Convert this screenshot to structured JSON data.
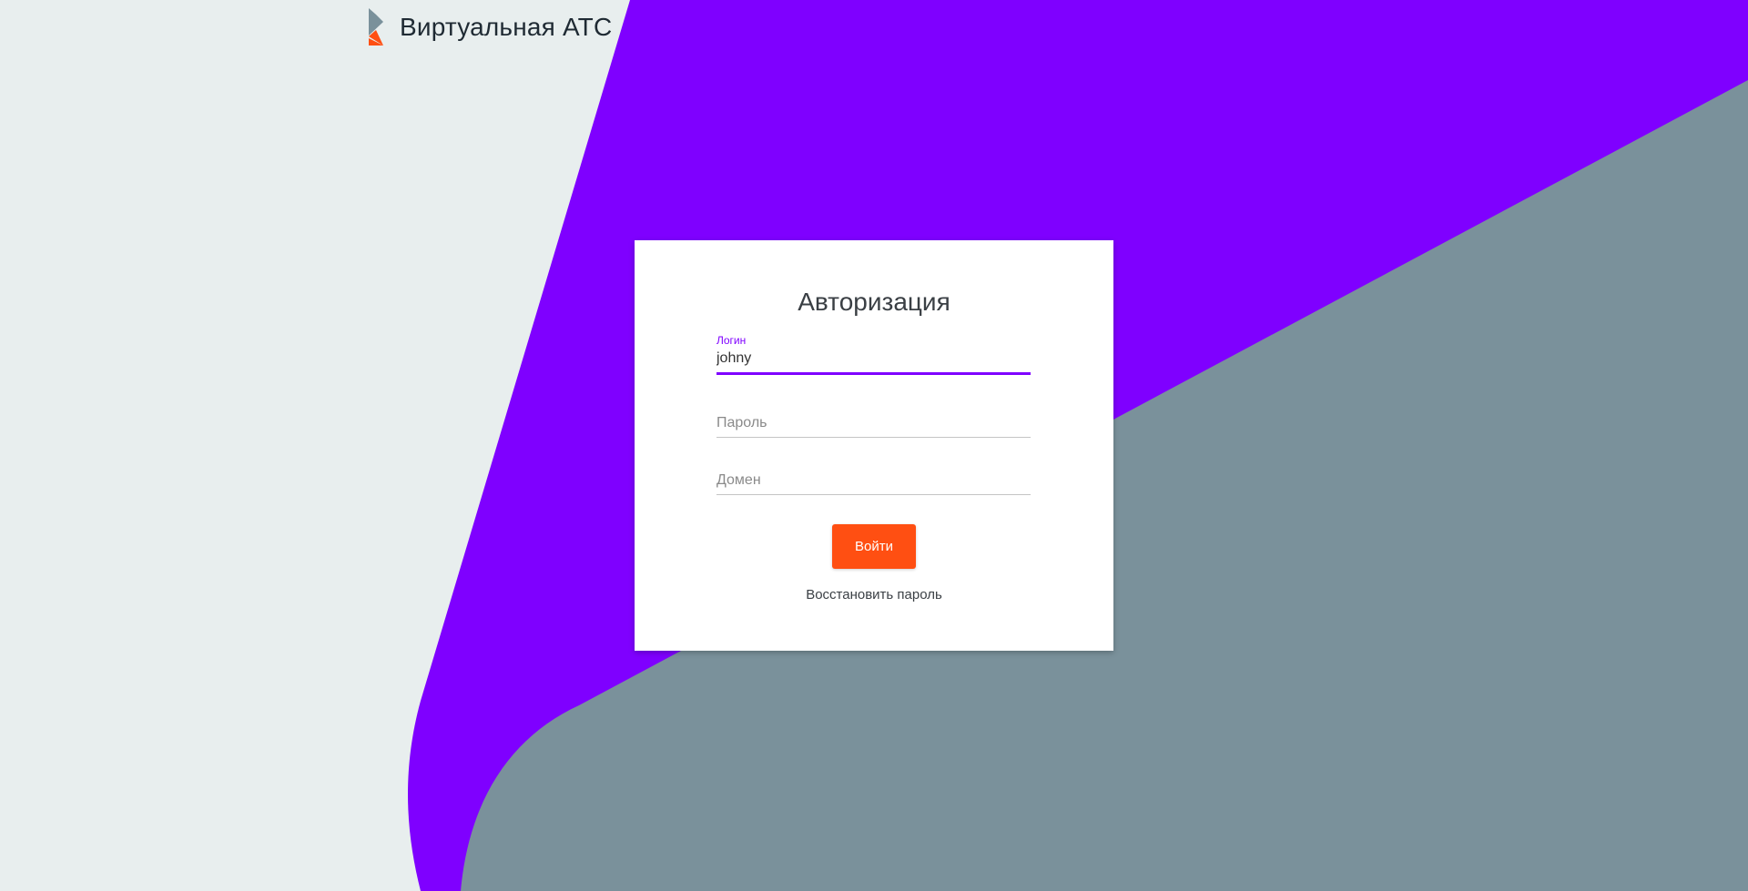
{
  "app": {
    "title": "Виртуальная АТС"
  },
  "colors": {
    "purple": "#7f00ff",
    "slate": "#7a919b",
    "background": "#e8eeee",
    "button": "#ff4f12"
  },
  "login_form": {
    "title": "Авторизация",
    "login": {
      "label": "Логин",
      "value": "johny"
    },
    "password": {
      "placeholder": "Пароль",
      "value": ""
    },
    "domain": {
      "placeholder": "Домен",
      "value": ""
    },
    "submit_label": "Войти",
    "restore_password_label": "Восстановить пароль"
  }
}
